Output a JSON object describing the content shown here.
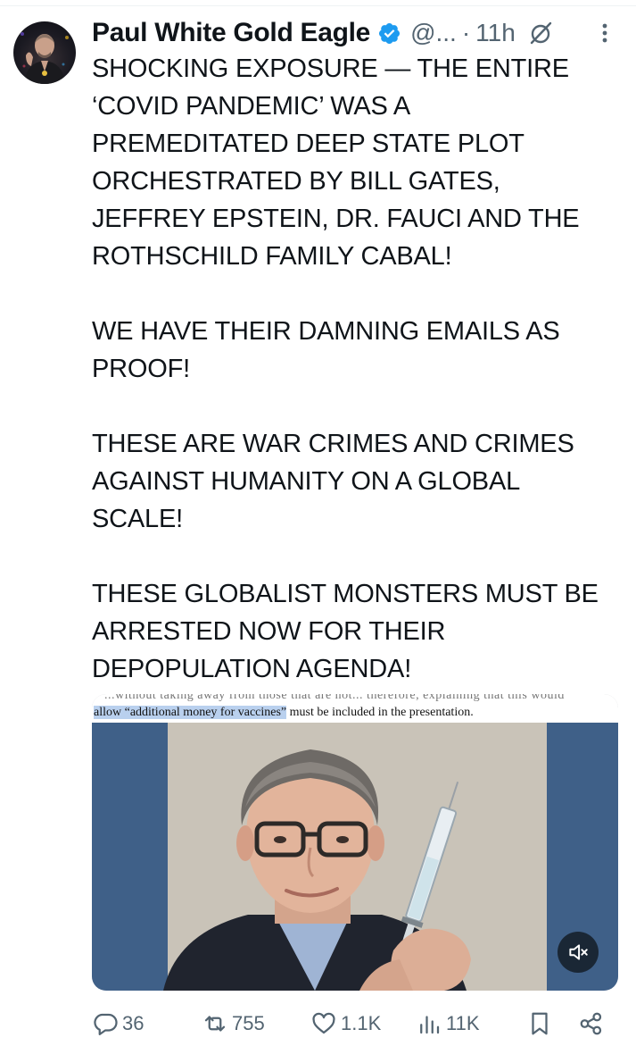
{
  "author": {
    "display_name": "Paul White Gold Eagle",
    "handle": "@...",
    "separator": "·",
    "time": "11h"
  },
  "tweet": {
    "text": "SHOCKING EXPOSURE — THE ENTIRE ‘COVID PANDEMIC’ WAS A PREMEDITATED DEEP STATE PLOT ORCHESTRATED BY BILL GATES, JEFFREY EPSTEIN, DR. FAUCI AND THE ROTHSCHILD FAMILY CABAL!\n\nWE HAVE THEIR DAMNING EMAILS AS PROOF!\n\nTHESE ARE WAR CRIMES AND CRIMES AGAINST HUMANITY ON A GLOBAL SCALE!\n\nTHESE GLOBALIST MONSTERS MUST BE ARRESTED NOW FOR THEIR DEPOPULATION AGENDA!"
  },
  "media": {
    "doc_faint_text": "...without taking away from those that are not... therefore, explaining that this would",
    "doc_highlight": "allow “additional money for vaccines”",
    "doc_rest": " must be included in the presentation."
  },
  "actions": {
    "replies": "36",
    "reposts": "755",
    "likes": "1.1K",
    "views": "11K"
  },
  "colors": {
    "text": "#0f1419",
    "muted": "#536471",
    "verified": "#1d9bf0",
    "highlight": "#b9d0ee"
  },
  "icons": [
    "verified-badge-icon",
    "grok-icon",
    "more-icon",
    "mute-icon",
    "reply-icon",
    "repost-icon",
    "like-icon",
    "views-icon",
    "bookmark-icon",
    "share-icon"
  ]
}
